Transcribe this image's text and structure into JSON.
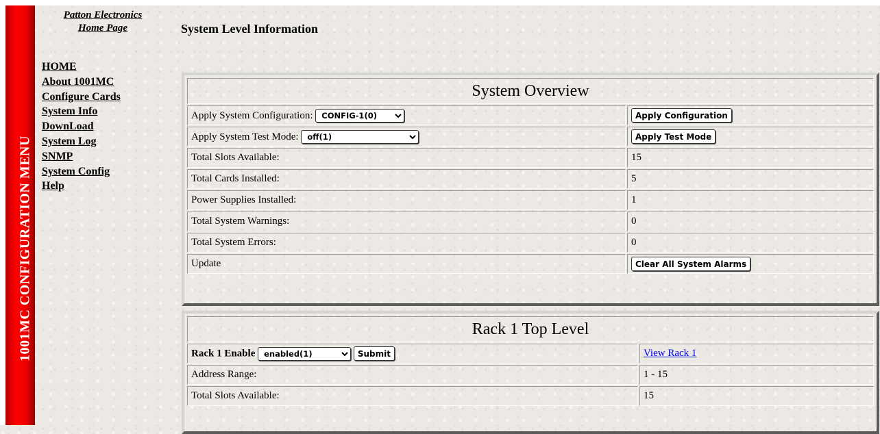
{
  "sidebar": {
    "vertical_title": "1001MC CONFIGURATION MENU",
    "logo_line1": "Patton Electronics",
    "logo_line2": "Home Page",
    "items": [
      {
        "label": "HOME"
      },
      {
        "label": "About 1001MC"
      },
      {
        "label": "Configure Cards"
      },
      {
        "label": "System Info"
      },
      {
        "label": "DownLoad"
      },
      {
        "label": "System Log"
      },
      {
        "label": "SNMP"
      },
      {
        "label": "System Config"
      },
      {
        "label": "Help"
      }
    ]
  },
  "page_title": "System Level Information",
  "overview": {
    "title": "System Overview",
    "apply_config_label": "Apply System Configuration:",
    "config_select": "CONFIG-1(0)",
    "apply_config_button": "Apply Configuration",
    "test_mode_label": "Apply System Test Mode:",
    "test_mode_select": "off(1)",
    "apply_test_mode_button": "Apply Test Mode",
    "rows": [
      {
        "label": "Total Slots Available:",
        "value": "15"
      },
      {
        "label": "Total Cards Installed:",
        "value": "5"
      },
      {
        "label": "Power Supplies Installed:",
        "value": "1"
      },
      {
        "label": "Total System Warnings:",
        "value": "0"
      },
      {
        "label": "Total System Errors:",
        "value": "0"
      }
    ],
    "update_label": "Update",
    "clear_alarms_button": "Clear All System Alarms"
  },
  "rack": {
    "title": "Rack 1 Top Level",
    "enable_label": "Rack 1 Enable",
    "enable_select": "enabled(1)",
    "submit_button": "Submit",
    "view_link": "View Rack 1",
    "rows": [
      {
        "label": "Address Range:",
        "value": "1 - 15"
      },
      {
        "label": "Total Slots Available:",
        "value": "15"
      }
    ]
  },
  "colors": {
    "menu_strip": "#ee0000",
    "link": "#0000ee"
  }
}
